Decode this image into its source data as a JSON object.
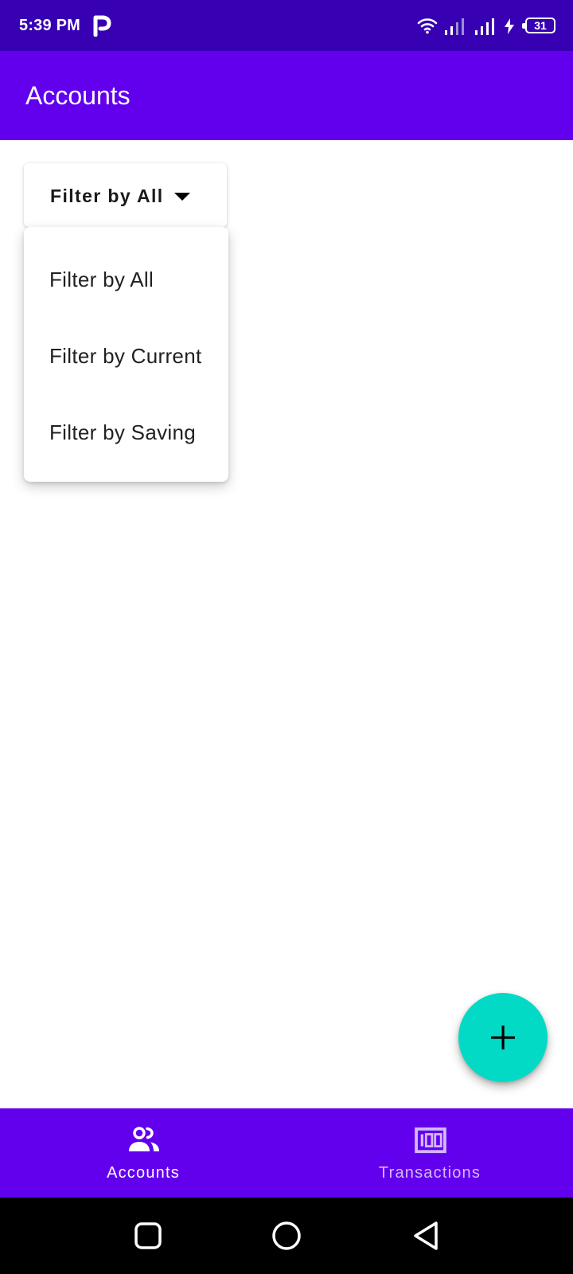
{
  "status_bar": {
    "time": "5:39 PM",
    "app_icon": "p-app-icon",
    "icons": [
      "wifi-icon",
      "signal-icon",
      "signal-icon",
      "charging-icon"
    ],
    "battery": "31"
  },
  "app_bar": {
    "title": "Accounts"
  },
  "filter": {
    "selected_label": "Filter by All",
    "options": [
      {
        "label": "Filter by All"
      },
      {
        "label": "Filter by Current"
      },
      {
        "label": "Filter by Saving"
      }
    ]
  },
  "fab": {
    "icon": "plus-icon",
    "color": "#03dac5"
  },
  "bottom_nav": {
    "items": [
      {
        "label": "Accounts",
        "icon": "people-icon",
        "active": true
      },
      {
        "label": "Transactions",
        "icon": "money-icon",
        "active": false
      }
    ]
  },
  "system_nav": {
    "buttons": [
      "recents-icon",
      "home-icon",
      "back-icon"
    ]
  },
  "colors": {
    "status_bar": "#3700b3",
    "primary": "#6200ee",
    "accent": "#03dac5",
    "system_nav": "#000000"
  }
}
